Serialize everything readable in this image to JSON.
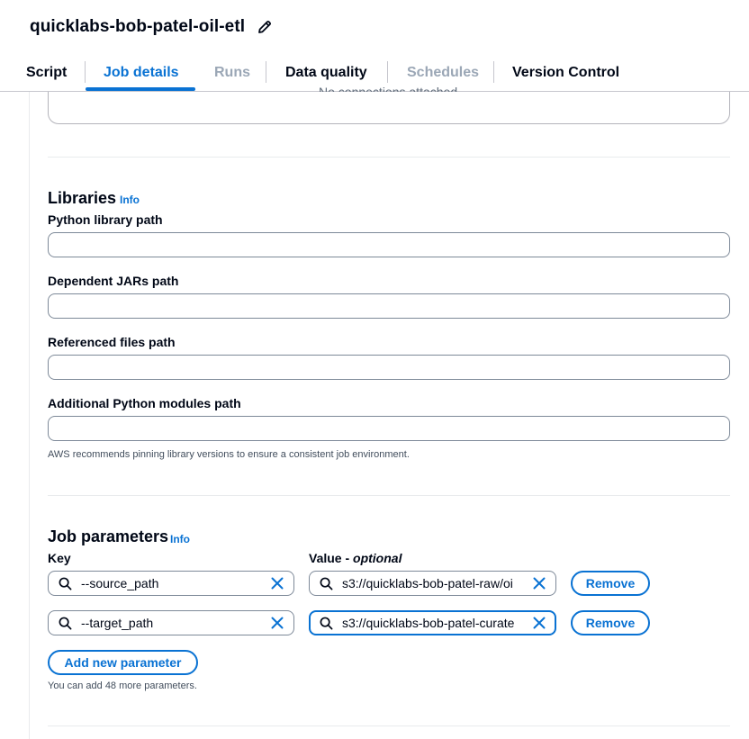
{
  "header": {
    "job_title": "quicklabs-bob-patel-oil-etl"
  },
  "tabs": [
    {
      "label": "Script",
      "state": "normal"
    },
    {
      "label": "Job details",
      "state": "active"
    },
    {
      "label": "Runs",
      "state": "disabled"
    },
    {
      "label": "Data quality",
      "state": "normal"
    },
    {
      "label": "Schedules",
      "state": "disabled"
    },
    {
      "label": "Version Control",
      "state": "normal"
    }
  ],
  "connections": {
    "empty_text": "No connections attached."
  },
  "libraries": {
    "title": "Libraries",
    "info": "Info",
    "python_library_path": {
      "label": "Python library path",
      "value": ""
    },
    "dependent_jars_path": {
      "label": "Dependent JARs path",
      "value": ""
    },
    "referenced_files_path": {
      "label": "Referenced files path",
      "value": ""
    },
    "additional_python_modules_path": {
      "label": "Additional Python modules path",
      "value": ""
    },
    "hint": "AWS recommends pinning library versions to ensure a consistent job environment."
  },
  "job_parameters": {
    "title": "Job parameters",
    "info": "Info",
    "key_label": "Key",
    "value_label": "Value - ",
    "value_label_optional": "optional",
    "rows": [
      {
        "key": "--source_path",
        "value": "s3://quicklabs-bob-patel-raw/oi",
        "remove_label": "Remove"
      },
      {
        "key": "--target_path",
        "value": "s3://quicklabs-bob-patel-curate",
        "remove_label": "Remove"
      }
    ],
    "add_label": "Add new parameter",
    "hint": "You can add 48 more parameters."
  },
  "colors": {
    "accent": "#0972d3",
    "text": "#000716",
    "disabled": "#9ba7b6",
    "border": "#7d8998"
  }
}
